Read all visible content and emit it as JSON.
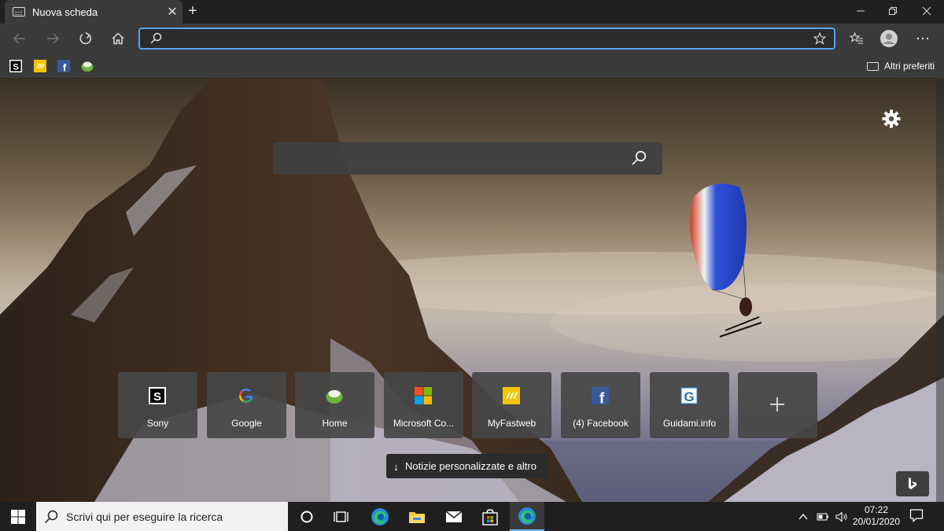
{
  "tab": {
    "title": "Nuova scheda",
    "close": "✕",
    "new": "+"
  },
  "window": {
    "minimize": "—",
    "maximize": "❐",
    "close": "✕"
  },
  "addressbar": {
    "value": "",
    "placeholder": ""
  },
  "favorites_bar": {
    "items": [
      {
        "name": "Sony",
        "icon": "sony-s-icon"
      },
      {
        "name": "MyFastweb",
        "icon": "fastweb-icon"
      },
      {
        "name": "Facebook",
        "icon": "facebook-icon"
      },
      {
        "name": "Home",
        "icon": "home-site-icon"
      }
    ],
    "other_favorites": "Altri preferiti"
  },
  "newtab": {
    "search_placeholder": "",
    "top_sites": [
      {
        "label": "Sony",
        "icon": "sony-icon"
      },
      {
        "label": "Google",
        "icon": "google-icon"
      },
      {
        "label": "Home",
        "icon": "home-site-icon"
      },
      {
        "label": "Microsoft Co...",
        "icon": "microsoft-icon"
      },
      {
        "label": "MyFastweb",
        "icon": "fastweb-icon"
      },
      {
        "label": "(4) Facebook",
        "icon": "facebook-icon"
      },
      {
        "label": "Guidami.info",
        "icon": "guidami-icon"
      },
      {
        "label": "",
        "icon": "add-icon"
      }
    ],
    "news_button": "Notizie personalizzate e altro",
    "news_arrow": "↓"
  },
  "taskbar": {
    "search_text": "Scrivi qui per eseguire la ricerca",
    "time": "07:22",
    "date": "20/01/2020"
  },
  "colors": {
    "accent": "#5ba3f0",
    "toolbar": "#3b3b3b",
    "titlebar": "#202020"
  }
}
